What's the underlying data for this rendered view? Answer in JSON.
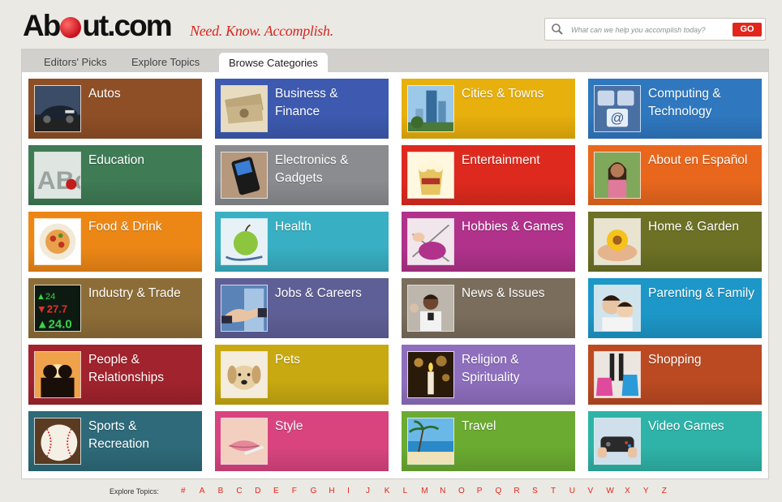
{
  "logo": {
    "text_before": "Ab",
    "text_after": "ut.com"
  },
  "tagline": "Need. Know. Accomplish.",
  "search": {
    "placeholder": "What can we help you accomplish today?",
    "button_label": "GO"
  },
  "tabs": [
    {
      "label": "Editors' Picks",
      "active": false
    },
    {
      "label": "Explore Topics",
      "active": false
    },
    {
      "label": "Browse Categories",
      "active": true
    }
  ],
  "categories": [
    {
      "label": "Autos",
      "color": "#8f4f26",
      "icon": "car-thumbnail"
    },
    {
      "label": "Business & Finance",
      "color": "#3d5ab0",
      "icon": "money-thumbnail"
    },
    {
      "label": "Cities & Towns",
      "color": "#e8b00c",
      "icon": "city-thumbnail"
    },
    {
      "label": "Computing & Technology",
      "color": "#2f78c0",
      "icon": "keyboard-thumbnail"
    },
    {
      "label": "Education",
      "color": "#3f7b55",
      "icon": "abc-blocks-thumbnail"
    },
    {
      "label": "Electronics & Gadgets",
      "color": "#8a8c90",
      "icon": "phone-thumbnail"
    },
    {
      "label": "Entertainment",
      "color": "#de2a1e",
      "icon": "popcorn-thumbnail"
    },
    {
      "label": "About en Español",
      "color": "#e8671d",
      "icon": "woman-thumbnail"
    },
    {
      "label": "Food & Drink",
      "color": "#ec8716",
      "icon": "pasta-thumbnail"
    },
    {
      "label": "Health",
      "color": "#39afc3",
      "icon": "apple-thumbnail"
    },
    {
      "label": "Hobbies & Games",
      "color": "#b0328b",
      "icon": "knitting-thumbnail"
    },
    {
      "label": "Home & Garden",
      "color": "#6c7125",
      "icon": "flower-thumbnail"
    },
    {
      "label": "Industry & Trade",
      "color": "#8d6d37",
      "icon": "stock-ticker-thumbnail"
    },
    {
      "label": "Jobs & Careers",
      "color": "#5f5f97",
      "icon": "handshake-thumbnail"
    },
    {
      "label": "News & Issues",
      "color": "#7a6d5c",
      "icon": "reporter-thumbnail"
    },
    {
      "label": "Parenting & Family",
      "color": "#1d97c8",
      "icon": "family-thumbnail"
    },
    {
      "label": "People & Relationships",
      "color": "#a1232d",
      "icon": "couple-thumbnail"
    },
    {
      "label": "Pets",
      "color": "#c8a911",
      "icon": "puppy-thumbnail"
    },
    {
      "label": "Religion & Spirituality",
      "color": "#8e6fbe",
      "icon": "candles-thumbnail"
    },
    {
      "label": "Shopping",
      "color": "#bb4a22",
      "icon": "shopping-bags-thumbnail"
    },
    {
      "label": "Sports & Recreation",
      "color": "#2e6a79",
      "icon": "baseball-thumbnail"
    },
    {
      "label": "Style",
      "color": "#d9447f",
      "icon": "lips-thumbnail"
    },
    {
      "label": "Travel",
      "color": "#6bab31",
      "icon": "beach-thumbnail"
    },
    {
      "label": "Video Games",
      "color": "#2fb3a8",
      "icon": "game-controller-thumbnail"
    }
  ],
  "footer": {
    "label": "Explore Topics:",
    "letters": [
      "#",
      "A",
      "B",
      "C",
      "D",
      "E",
      "F",
      "G",
      "H",
      "I",
      "J",
      "K",
      "L",
      "M",
      "N",
      "O",
      "P",
      "Q",
      "R",
      "S",
      "T",
      "U",
      "V",
      "W",
      "X",
      "Y",
      "Z"
    ]
  }
}
